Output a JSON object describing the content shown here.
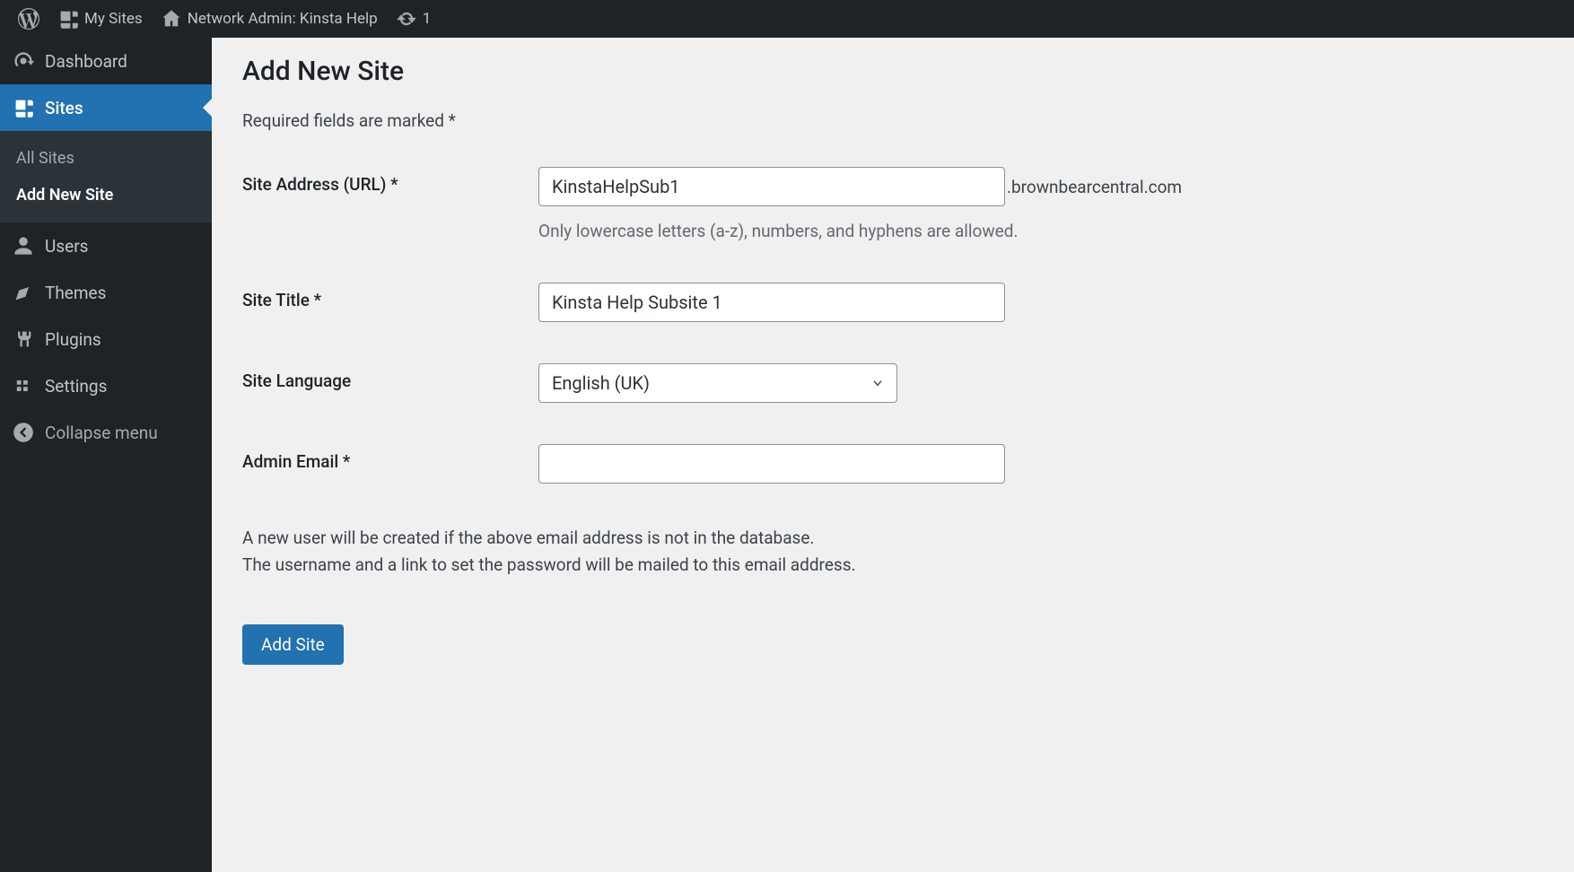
{
  "adminbar": {
    "my_sites": "My Sites",
    "network_admin": "Network Admin: Kinsta Help",
    "updates_count": "1"
  },
  "sidebar": {
    "dashboard": "Dashboard",
    "sites": "Sites",
    "all_sites": "All Sites",
    "add_new_site": "Add New Site",
    "users": "Users",
    "themes": "Themes",
    "plugins": "Plugins",
    "settings": "Settings",
    "collapse": "Collapse menu"
  },
  "page": {
    "title": "Add New Site",
    "required_note": "Required fields are marked *",
    "labels": {
      "site_address": "Site Address (URL) *",
      "site_title": "Site Title *",
      "site_language": "Site Language",
      "admin_email": "Admin Email *"
    },
    "values": {
      "site_address": "KinstaHelpSub1",
      "domain_suffix": ".brownbearcentral.com",
      "site_title": "Kinsta Help Subsite 1",
      "site_language": "English (UK)",
      "admin_email": ""
    },
    "hints": {
      "address_hint": "Only lowercase letters (a-z), numbers, and hyphens are allowed."
    },
    "info_line1": "A new user will be created if the above email address is not in the database.",
    "info_line2": "The username and a link to set the password will be mailed to this email address.",
    "submit_label": "Add Site"
  }
}
